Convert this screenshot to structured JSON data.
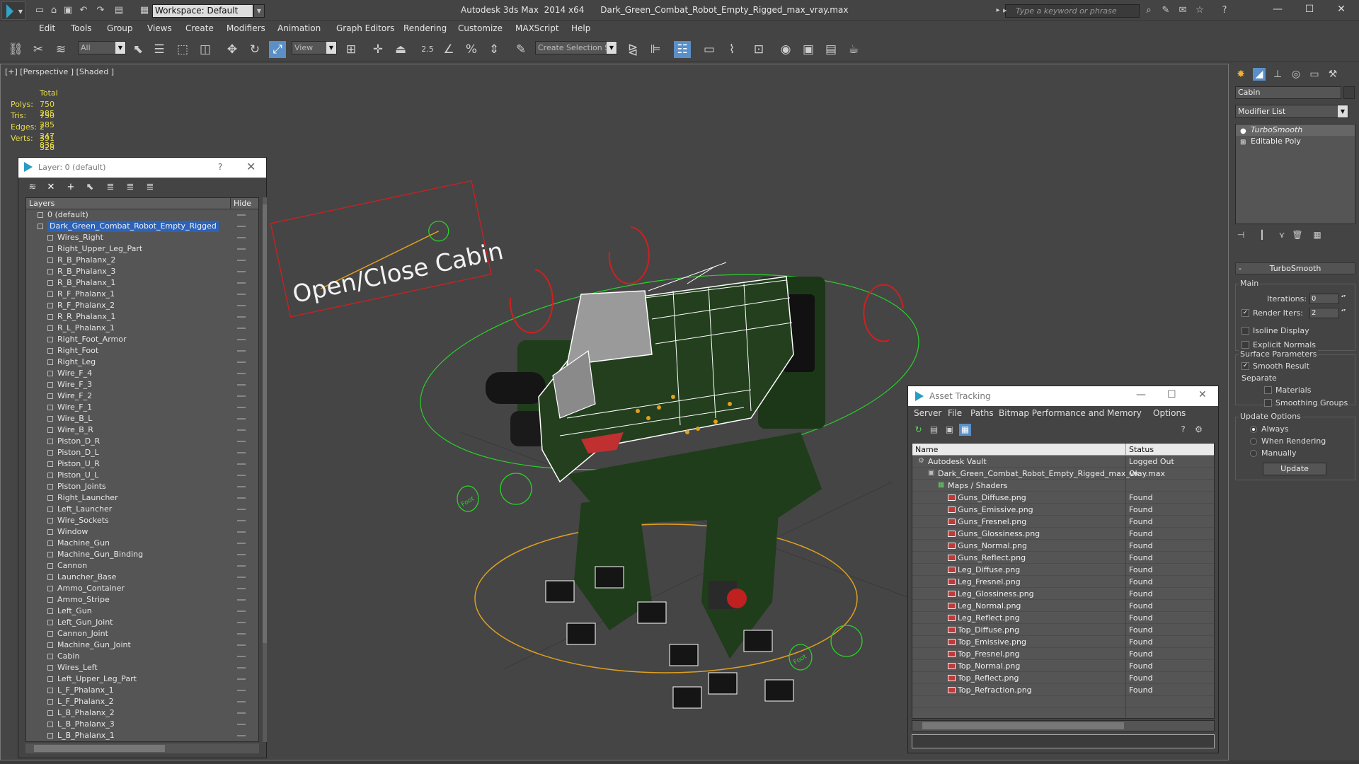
{
  "app": {
    "window_title": "Autodesk 3ds Max  2014 x64      Dark_Green_Combat_Robot_Empty_Rigged_max_vray.max",
    "workspace": "Workspace: Default",
    "search_placeholder": "Type a keyword or phrase"
  },
  "menu": [
    "Edit",
    "Tools",
    "Group",
    "Views",
    "Create",
    "Modifiers",
    "Animation",
    "Graph Editors",
    "Rendering",
    "Customize",
    "MAXScript",
    "Help"
  ],
  "toolbar": {
    "filter_select": "All",
    "ref_coord_select": "View",
    "selection_set_placeholder": "Create Selection Se",
    "snap_angle_label": "2.5"
  },
  "viewport": {
    "label": "[+] [Perspective ] [Shaded ]",
    "stats": {
      "header": "Total",
      "rows": [
        {
          "label": "Polys:",
          "value": "750 285"
        },
        {
          "label": "Tris:",
          "value": "750 285"
        },
        {
          "label": "Edges:",
          "value": "2 247 836"
        },
        {
          "label": "Verts:",
          "value": "391 328"
        }
      ]
    },
    "control_label": "Open/Close Cabin",
    "foot_label": "Foot",
    "colors": {
      "background": "#454545",
      "robot": "#1f3d1a",
      "wire": "#ffffff",
      "helper_green": "#2ad12a",
      "helper_red": "#d02020",
      "helper_orange": "#e0a020"
    }
  },
  "layer_panel": {
    "title": "Layer: 0 (default)",
    "help": "?",
    "col_layers": "Layers",
    "col_hide": "Hide",
    "layers": [
      {
        "name": "0 (default)",
        "level": 0,
        "type": "layer"
      },
      {
        "name": "Dark_Green_Combat_Robot_Empty_Rigged",
        "level": 0,
        "type": "layer",
        "selected": true
      },
      {
        "name": "Wires_Right",
        "level": 1,
        "type": "obj"
      },
      {
        "name": "Right_Upper_Leg_Part",
        "level": 1,
        "type": "obj"
      },
      {
        "name": "R_B_Phalanx_2",
        "level": 1,
        "type": "obj"
      },
      {
        "name": "R_B_Phalanx_3",
        "level": 1,
        "type": "obj"
      },
      {
        "name": "R_B_Phalanx_1",
        "level": 1,
        "type": "obj"
      },
      {
        "name": "R_F_Phalanx_1",
        "level": 1,
        "type": "obj"
      },
      {
        "name": "R_F_Phalanx_2",
        "level": 1,
        "type": "obj"
      },
      {
        "name": "R_R_Phalanx_1",
        "level": 1,
        "type": "obj"
      },
      {
        "name": "R_L_Phalanx_1",
        "level": 1,
        "type": "obj"
      },
      {
        "name": "Right_Foot_Armor",
        "level": 1,
        "type": "obj"
      },
      {
        "name": "Right_Foot",
        "level": 1,
        "type": "obj"
      },
      {
        "name": "Right_Leg",
        "level": 1,
        "type": "obj"
      },
      {
        "name": "Wire_F_4",
        "level": 1,
        "type": "obj"
      },
      {
        "name": "Wire_F_3",
        "level": 1,
        "type": "obj"
      },
      {
        "name": "Wire_F_2",
        "level": 1,
        "type": "obj"
      },
      {
        "name": "Wire_F_1",
        "level": 1,
        "type": "obj"
      },
      {
        "name": "Wire_B_L",
        "level": 1,
        "type": "obj"
      },
      {
        "name": "Wire_B_R",
        "level": 1,
        "type": "obj"
      },
      {
        "name": "Piston_D_R",
        "level": 1,
        "type": "obj"
      },
      {
        "name": "Piston_D_L",
        "level": 1,
        "type": "obj"
      },
      {
        "name": "Piston_U_R",
        "level": 1,
        "type": "obj"
      },
      {
        "name": "Piston_U_L",
        "level": 1,
        "type": "obj"
      },
      {
        "name": "Piston_Joints",
        "level": 1,
        "type": "obj"
      },
      {
        "name": "Right_Launcher",
        "level": 1,
        "type": "obj"
      },
      {
        "name": "Left_Launcher",
        "level": 1,
        "type": "obj"
      },
      {
        "name": "Wire_Sockets",
        "level": 1,
        "type": "obj"
      },
      {
        "name": "Window",
        "level": 1,
        "type": "obj"
      },
      {
        "name": "Machine_Gun",
        "level": 1,
        "type": "obj"
      },
      {
        "name": "Machine_Gun_Binding",
        "level": 1,
        "type": "obj"
      },
      {
        "name": "Cannon",
        "level": 1,
        "type": "obj"
      },
      {
        "name": "Launcher_Base",
        "level": 1,
        "type": "obj"
      },
      {
        "name": "Ammo_Container",
        "level": 1,
        "type": "obj"
      },
      {
        "name": "Ammo_Stripe",
        "level": 1,
        "type": "obj"
      },
      {
        "name": "Left_Gun",
        "level": 1,
        "type": "obj"
      },
      {
        "name": "Left_Gun_Joint",
        "level": 1,
        "type": "obj"
      },
      {
        "name": "Cannon_Joint",
        "level": 1,
        "type": "obj"
      },
      {
        "name": "Machine_Gun_Joint",
        "level": 1,
        "type": "obj"
      },
      {
        "name": "Cabin",
        "level": 1,
        "type": "obj"
      },
      {
        "name": "Wires_Left",
        "level": 1,
        "type": "obj"
      },
      {
        "name": "Left_Upper_Leg_Part",
        "level": 1,
        "type": "obj"
      },
      {
        "name": "L_F_Phalanx_1",
        "level": 1,
        "type": "obj"
      },
      {
        "name": "L_F_Phalanx_2",
        "level": 1,
        "type": "obj"
      },
      {
        "name": "L_B_Phalanx_2",
        "level": 1,
        "type": "obj"
      },
      {
        "name": "L_B_Phalanx_3",
        "level": 1,
        "type": "obj"
      },
      {
        "name": "L_B_Phalanx_1",
        "level": 1,
        "type": "obj"
      }
    ]
  },
  "asset_panel": {
    "title": "Asset Tracking",
    "menu": [
      "Server",
      "File",
      "Paths",
      "Bitmap Performance and Memory",
      "Options"
    ],
    "col_name": "Name",
    "col_status": "Status",
    "rows": [
      {
        "name": "Autodesk Vault",
        "status": "Logged Out",
        "level": 0,
        "type": "vault"
      },
      {
        "name": "Dark_Green_Combat_Robot_Empty_Rigged_max_vray.max",
        "status": "Ok",
        "level": 1,
        "type": "max"
      },
      {
        "name": "Maps / Shaders",
        "status": "",
        "level": 2,
        "type": "maps"
      },
      {
        "name": "Guns_Diffuse.png",
        "status": "Found",
        "level": 3,
        "type": "png"
      },
      {
        "name": "Guns_Emissive.png",
        "status": "Found",
        "level": 3,
        "type": "png"
      },
      {
        "name": "Guns_Fresnel.png",
        "status": "Found",
        "level": 3,
        "type": "png"
      },
      {
        "name": "Guns_Glossiness.png",
        "status": "Found",
        "level": 3,
        "type": "png"
      },
      {
        "name": "Guns_Normal.png",
        "status": "Found",
        "level": 3,
        "type": "png"
      },
      {
        "name": "Guns_Reflect.png",
        "status": "Found",
        "level": 3,
        "type": "png"
      },
      {
        "name": "Leg_Diffuse.png",
        "status": "Found",
        "level": 3,
        "type": "png"
      },
      {
        "name": "Leg_Fresnel.png",
        "status": "Found",
        "level": 3,
        "type": "png"
      },
      {
        "name": "Leg_Glossiness.png",
        "status": "Found",
        "level": 3,
        "type": "png"
      },
      {
        "name": "Leg_Normal.png",
        "status": "Found",
        "level": 3,
        "type": "png"
      },
      {
        "name": "Leg_Reflect.png",
        "status": "Found",
        "level": 3,
        "type": "png"
      },
      {
        "name": "Top_Diffuse.png",
        "status": "Found",
        "level": 3,
        "type": "png"
      },
      {
        "name": "Top_Emissive.png",
        "status": "Found",
        "level": 3,
        "type": "png"
      },
      {
        "name": "Top_Fresnel.png",
        "status": "Found",
        "level": 3,
        "type": "png"
      },
      {
        "name": "Top_Normal.png",
        "status": "Found",
        "level": 3,
        "type": "png"
      },
      {
        "name": "Top_Reflect.png",
        "status": "Found",
        "level": 3,
        "type": "png"
      },
      {
        "name": "Top_Refraction.png",
        "status": "Found",
        "level": 3,
        "type": "png"
      }
    ]
  },
  "command_panel": {
    "object_name": "Cabin",
    "modifier_list": "Modifier List",
    "stack": [
      "TurboSmooth",
      "Editable Poly"
    ],
    "turbosmooth": {
      "title": "TurboSmooth",
      "main_group": "Main",
      "iterations_label": "Iterations:",
      "iterations_value": "0",
      "render_iters_label": "Render Iters:",
      "render_iters_value": "2",
      "isoline_label": "Isoline Display",
      "explicit_normals_label": "Explicit Normals",
      "surface_group": "Surface Parameters",
      "smooth_result_label": "Smooth Result",
      "separate_label": "Separate",
      "materials_label": "Materials",
      "smoothing_groups_label": "Smoothing Groups",
      "update_group": "Update Options",
      "always_label": "Always",
      "when_rendering_label": "When Rendering",
      "manually_label": "Manually",
      "update_button": "Update"
    }
  }
}
